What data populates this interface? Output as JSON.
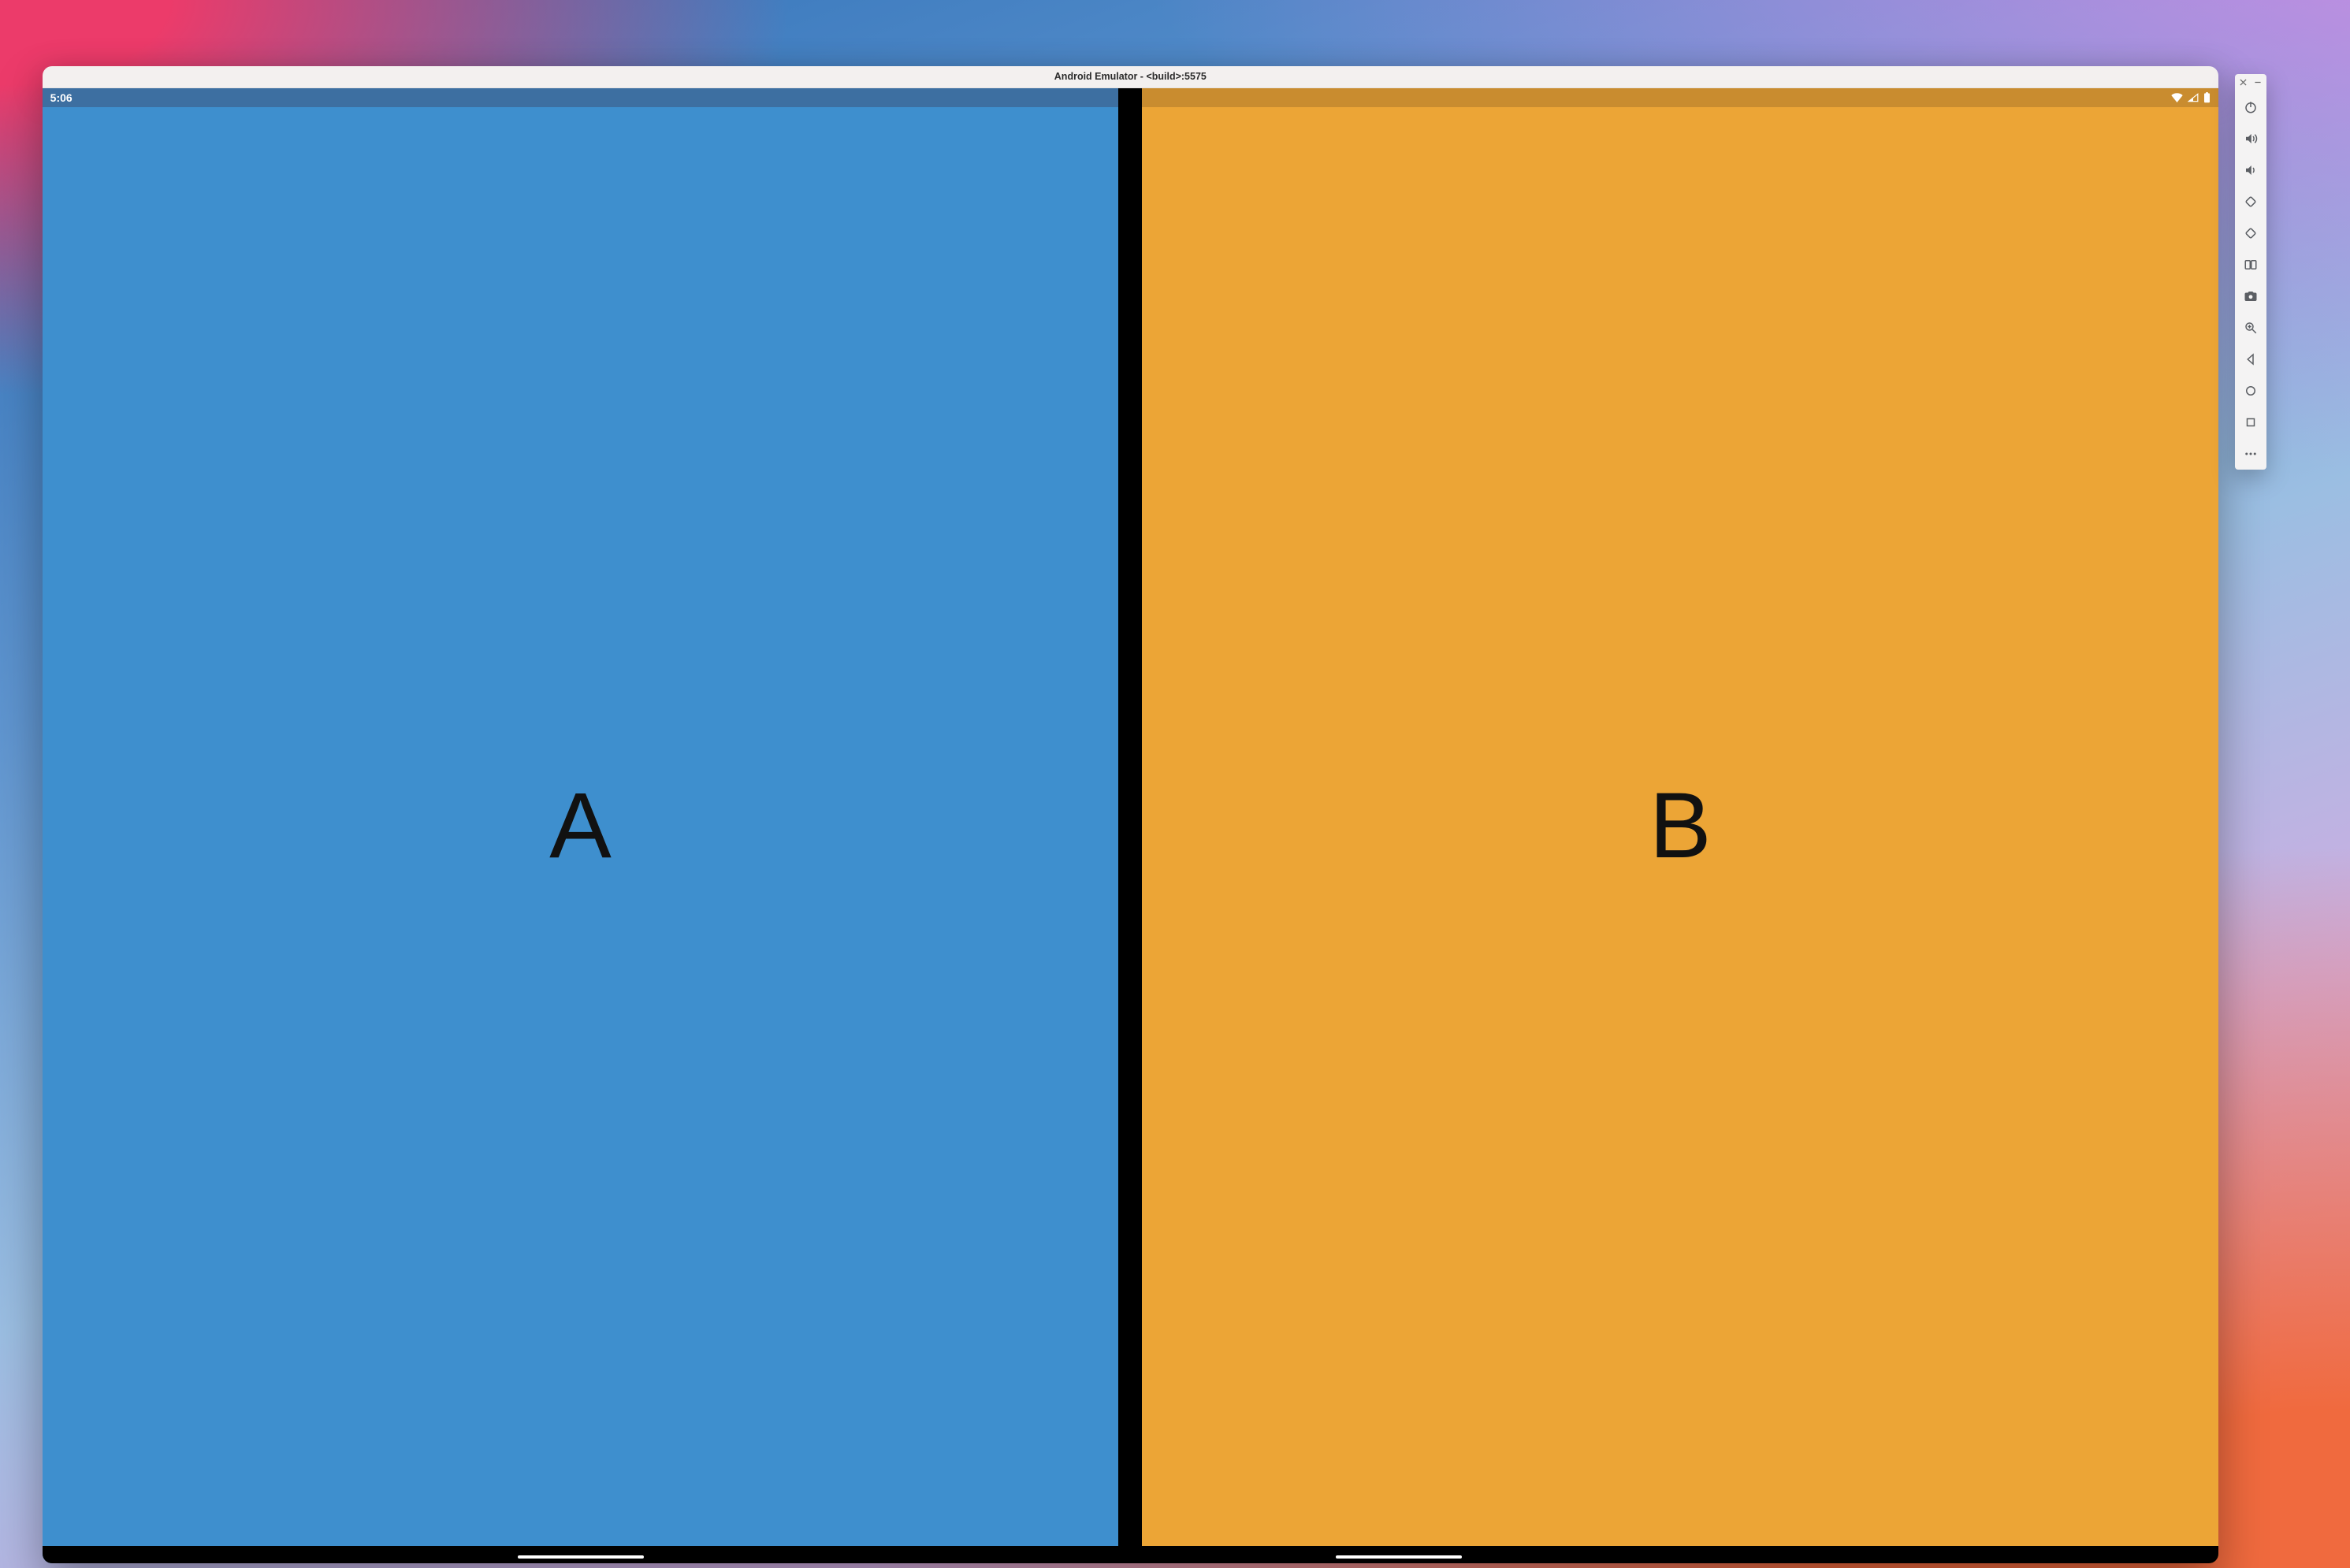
{
  "window": {
    "title": "Android Emulator - <build>:5575"
  },
  "status": {
    "time": "5:06",
    "icons": {
      "wifi": "wifi-icon",
      "signal": "cell-signal-icon",
      "battery": "battery-icon"
    }
  },
  "colors": {
    "pane_a_bg": "#3e8fce",
    "pane_b_bg": "#eca536",
    "status_a_bg": "#3d6fa1",
    "status_b_bg": "#c98c2f"
  },
  "panes": {
    "a": {
      "label": "A"
    },
    "b": {
      "label": "B"
    }
  },
  "toolbar": {
    "head": {
      "close": "close",
      "minimize": "minimize"
    },
    "items": [
      {
        "id": "power",
        "icon": "power-icon"
      },
      {
        "id": "volume-up",
        "icon": "volume-up-icon"
      },
      {
        "id": "volume-down",
        "icon": "volume-down-icon"
      },
      {
        "id": "rotate-left",
        "icon": "rotate-left-icon"
      },
      {
        "id": "rotate-right",
        "icon": "rotate-right-icon"
      },
      {
        "id": "fold",
        "icon": "fold-device-icon"
      },
      {
        "id": "camera",
        "icon": "camera-icon"
      },
      {
        "id": "zoom",
        "icon": "zoom-icon"
      },
      {
        "id": "back",
        "icon": "back-icon"
      },
      {
        "id": "home",
        "icon": "home-icon"
      },
      {
        "id": "overview",
        "icon": "overview-icon"
      },
      {
        "id": "more",
        "icon": "more-icon"
      }
    ]
  }
}
